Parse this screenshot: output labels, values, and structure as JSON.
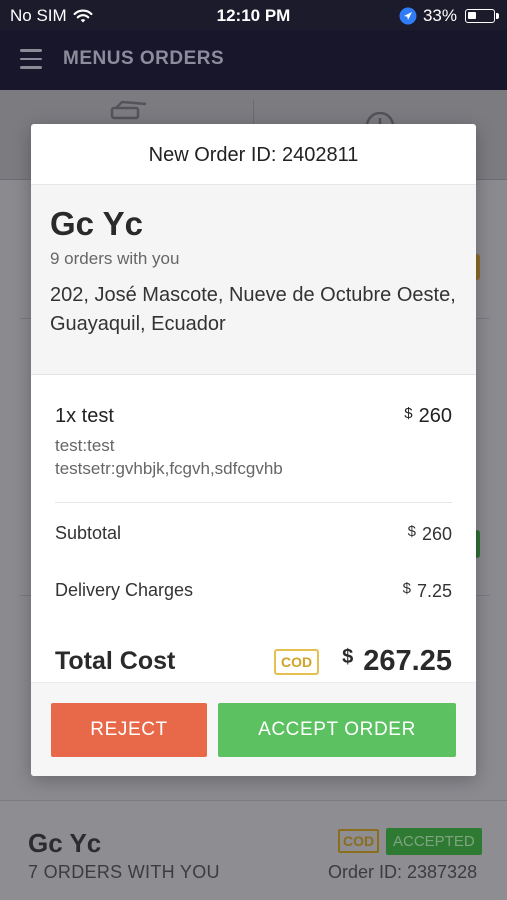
{
  "status_bar": {
    "carrier": "No SIM",
    "time": "12:10 PM",
    "battery": "33%"
  },
  "app": {
    "title": "MENUS ORDERS"
  },
  "background": {
    "customer_name": "Gc Yc",
    "orders_with_you": "7 ORDERS WITH YOU",
    "payment_badge": "COD",
    "status_badge": "ACCEPTED",
    "order_id": "Order ID: 2387328"
  },
  "modal": {
    "header": "New Order ID: 2402811",
    "customer": {
      "name": "Gc Yc",
      "orders_count": "9 orders with you",
      "address": "202, José Mascote, Nueve de Octubre Oeste, Guayaquil, Ecuador"
    },
    "item": {
      "title": "1x test",
      "currency": "$",
      "price": "260",
      "note1": "test:test",
      "note2": "testsetr:gvhbjk,fcgvh,sdfcgvhb"
    },
    "subtotal": {
      "label": "Subtotal",
      "currency": "$",
      "value": "260"
    },
    "delivery": {
      "label": "Delivery Charges",
      "currency": "$",
      "value": "7.25"
    },
    "total": {
      "label": "Total Cost",
      "badge": "COD",
      "currency": "$",
      "value": "267.25"
    },
    "buttons": {
      "reject": "REJECT",
      "accept": "ACCEPT ORDER"
    }
  },
  "colors": {
    "reject": "#e8694a",
    "accept": "#5cc160",
    "cod": "#d0a227",
    "header": "#17162a"
  }
}
